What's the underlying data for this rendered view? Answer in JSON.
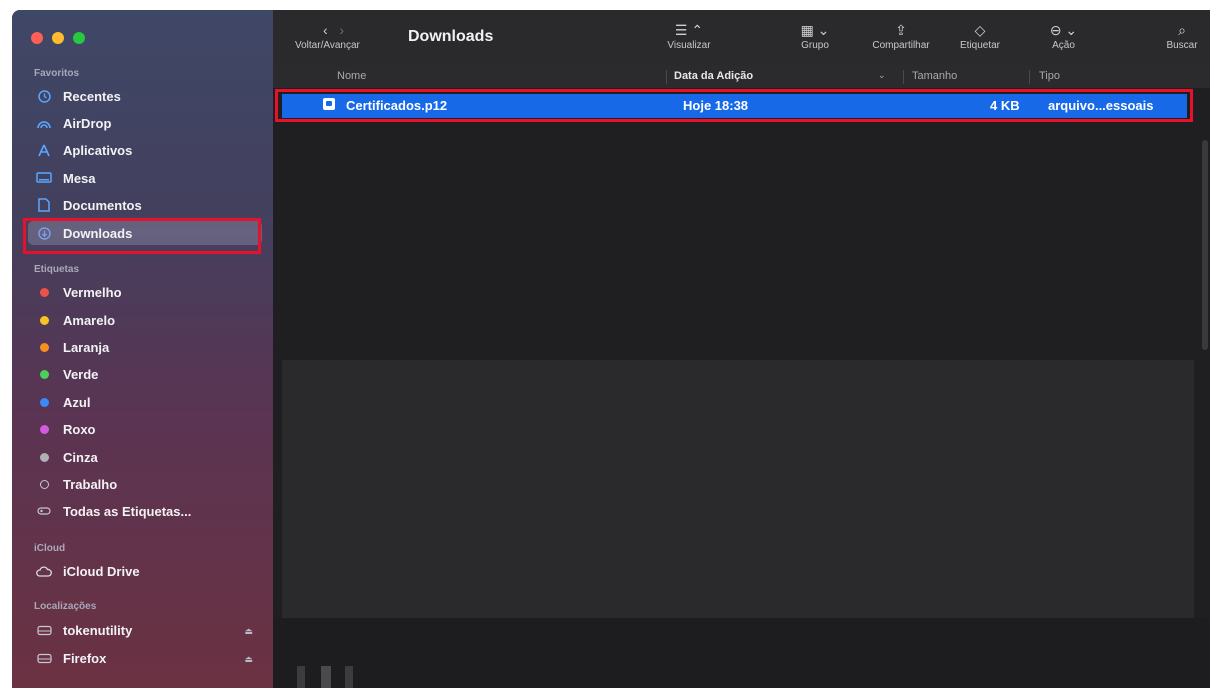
{
  "sidebar": {
    "sections": {
      "favorites": "Favoritos",
      "tags": "Etiquetas",
      "icloud": "iCloud",
      "locations": "Localizações"
    },
    "favorites": [
      {
        "label": "Recentes",
        "icon": "clock-icon"
      },
      {
        "label": "AirDrop",
        "icon": "airdrop-icon"
      },
      {
        "label": "Aplicativos",
        "icon": "applications-icon"
      },
      {
        "label": "Mesa",
        "icon": "desktop-icon"
      },
      {
        "label": "Documentos",
        "icon": "document-icon"
      },
      {
        "label": "Downloads",
        "icon": "download-icon"
      }
    ],
    "tags": [
      {
        "label": "Vermelho",
        "color": "#f0524b"
      },
      {
        "label": "Amarelo",
        "color": "#f7c325"
      },
      {
        "label": "Laranja",
        "color": "#f5901f"
      },
      {
        "label": "Verde",
        "color": "#4bd05a"
      },
      {
        "label": "Azul",
        "color": "#3a8bf7"
      },
      {
        "label": "Roxo",
        "color": "#d45ae0"
      },
      {
        "label": "Cinza",
        "color": "#b0b0b4"
      },
      {
        "label": "Trabalho",
        "color": "outline"
      },
      {
        "label": "Todas as Etiquetas...",
        "color": "all"
      }
    ],
    "icloud": [
      {
        "label": "iCloud Drive",
        "icon": "cloud-icon"
      }
    ],
    "locations": [
      {
        "label": "tokenutility",
        "icon": "drive-icon"
      },
      {
        "label": "Firefox",
        "icon": "drive-icon"
      }
    ]
  },
  "toolbar": {
    "nav_label": "Voltar/Avançar",
    "title": "Downloads",
    "view_label": "Visualizar",
    "group_label": "Grupo",
    "share_label": "Compartilhar",
    "tag_label": "Etiquetar",
    "action_label": "Ação",
    "search_label": "Buscar"
  },
  "columns": {
    "name": "Nome",
    "date": "Data da Adição",
    "size": "Tamanho",
    "type": "Tipo"
  },
  "files": [
    {
      "name": "Certificados.p12",
      "date": "Hoje 18:38",
      "size": "4 KB",
      "type": "arquivo...essoais"
    }
  ],
  "colors": {
    "selection": "#1769e8",
    "highlight": "#e8102a"
  }
}
